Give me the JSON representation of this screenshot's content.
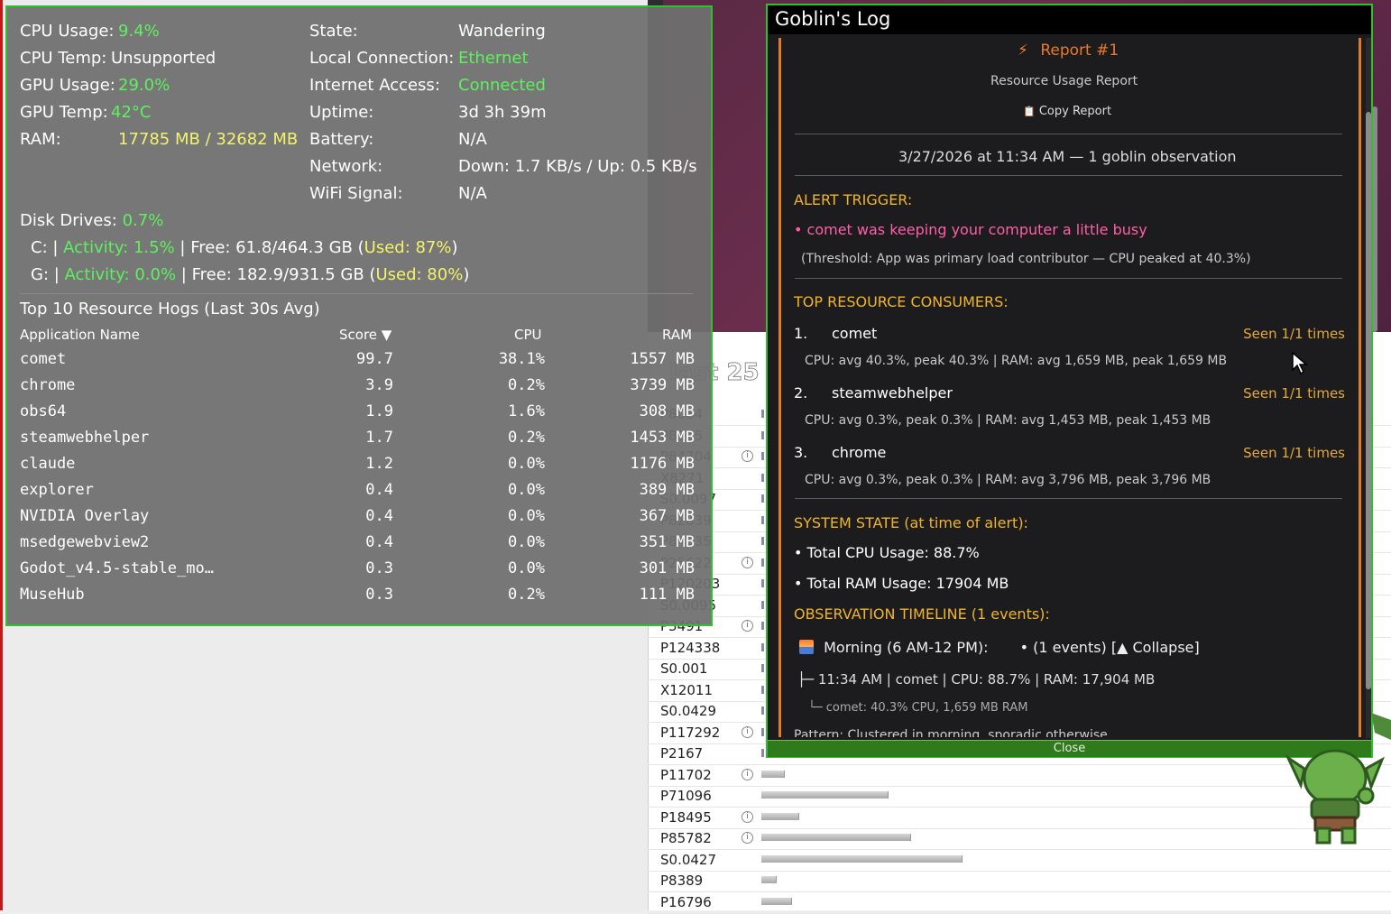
{
  "stats": {
    "left": [
      {
        "label": "CPU Usage:",
        "value": "9.4%",
        "color": "green"
      },
      {
        "label": "CPU Temp:",
        "value": "Unsupported",
        "color": "white"
      },
      {
        "label": "GPU Usage:",
        "value": "29.0%",
        "color": "green"
      },
      {
        "label": "GPU Temp:",
        "value": "42°C",
        "color": "green"
      },
      {
        "label": "RAM:",
        "value": "17785 MB / 32682 MB",
        "color": "yellow"
      }
    ],
    "right": [
      {
        "label": "State:",
        "value": "Wandering",
        "color": "white"
      },
      {
        "label": "Local Connection:",
        "value": "Ethernet",
        "color": "green"
      },
      {
        "label": "Internet Access:",
        "value": "Connected",
        "color": "green"
      },
      {
        "label": "Uptime:",
        "value": "3d 3h 39m",
        "color": "white"
      },
      {
        "label": "Battery:",
        "value": "N/A",
        "color": "white"
      },
      {
        "label": "Network:",
        "value": "Down: 1.7 KB/s / Up: 0.5 KB/s",
        "color": "white"
      },
      {
        "label": "WiFi Signal:",
        "value": "N/A",
        "color": "white"
      }
    ],
    "disk": {
      "label": "Disk Drives:",
      "value": "0.7%",
      "drives": [
        {
          "name": "C:",
          "activity": "Activity: 1.5%",
          "free": "Free: 61.8/464.3 GB",
          "used": "Used: 87%"
        },
        {
          "name": "G:",
          "activity": "Activity: 0.0%",
          "free": "Free: 182.9/931.5 GB",
          "used": "Used: 80%"
        }
      ]
    },
    "top_title": "Top 10 Resource Hogs (Last 30s Avg)",
    "columns": {
      "name": "Application Name",
      "score": "Score ▼",
      "cpu": "CPU",
      "ram": "RAM"
    },
    "apps": [
      {
        "name": "comet",
        "score": "99.7",
        "cpu": "38.1%",
        "ram": "1557 MB"
      },
      {
        "name": "chrome",
        "score": "3.9",
        "cpu": "0.2%",
        "ram": "3739 MB"
      },
      {
        "name": "obs64",
        "score": "1.9",
        "cpu": "1.6%",
        "ram": "308 MB"
      },
      {
        "name": "steamwebhelper",
        "score": "1.7",
        "cpu": "0.2%",
        "ram": "1453 MB"
      },
      {
        "name": "claude",
        "score": "1.2",
        "cpu": "0.0%",
        "ram": "1176 MB"
      },
      {
        "name": "explorer",
        "score": "0.4",
        "cpu": "0.0%",
        "ram": "389 MB"
      },
      {
        "name": "NVIDIA Overlay",
        "score": "0.4",
        "cpu": "0.0%",
        "ram": "367 MB"
      },
      {
        "name": "msedgewebview2",
        "score": "0.4",
        "cpu": "0.0%",
        "ram": "351 MB"
      },
      {
        "name": "Godot_v4.5-stable_mo…",
        "score": "0.3",
        "cpu": "0.0%",
        "ram": "301 MB"
      },
      {
        "name": "MuseHub",
        "score": "0.3",
        "cpu": "0.2%",
        "ram": "111 MB"
      }
    ]
  },
  "background": {
    "overlay_text": "last 25",
    "rows": [
      {
        "label": "P8084",
        "info": false,
        "bar": 0
      },
      {
        "label": "P8005",
        "info": false,
        "bar": 0
      },
      {
        "label": "P84704",
        "info": true,
        "bar": 0
      },
      {
        "label": "X8271",
        "info": false,
        "bar": 0
      },
      {
        "label": "S0.0097",
        "info": false,
        "bar": 0
      },
      {
        "label": "P82839",
        "info": false,
        "bar": 0
      },
      {
        "label": "P84035",
        "info": false,
        "bar": 0
      },
      {
        "label": "P25622",
        "info": true,
        "bar": 0
      },
      {
        "label": "P120203",
        "info": false,
        "bar": 0
      },
      {
        "label": "S0.0095",
        "info": false,
        "bar": 0
      },
      {
        "label": "P3491",
        "info": true,
        "bar": 0
      },
      {
        "label": "P124338",
        "info": false,
        "bar": 0
      },
      {
        "label": "S0.001",
        "info": false,
        "bar": 0
      },
      {
        "label": "X12011",
        "info": false,
        "bar": 0
      },
      {
        "label": "S0.0429",
        "info": false,
        "bar": 0
      },
      {
        "label": "P117292",
        "info": true,
        "bar": 0
      },
      {
        "label": "P2167",
        "info": false,
        "bar": 0
      },
      {
        "label": "P11702",
        "info": true,
        "bar": 0.03
      },
      {
        "label": "P71096",
        "info": false,
        "bar": 0.17
      },
      {
        "label": "P18495",
        "info": true,
        "bar": 0.05
      },
      {
        "label": "P85782",
        "info": true,
        "bar": 0.2
      },
      {
        "label": "S0.0427",
        "info": false,
        "bar": 0.27
      },
      {
        "label": "P8389",
        "info": false,
        "bar": 0.02
      },
      {
        "label": "P16796",
        "info": false,
        "bar": 0.04
      }
    ]
  },
  "log": {
    "title": "Goblin's Log",
    "report_icon": "⚡",
    "report_title": "Report #1",
    "subtitle": "Resource Usage Report",
    "copy_icon": "📋",
    "copy_label": "Copy Report",
    "date_line": "3/27/2026 at 11:34 AM — 1 goblin observation",
    "alert_heading": "ALERT TRIGGER:",
    "alert_text": "• comet was keeping your computer a little busy",
    "threshold": "(Threshold: App was primary load contributor — CPU peaked at 40.3%)",
    "consumers_heading": "TOP RESOURCE CONSUMERS:",
    "consumers": [
      {
        "rank": "1.",
        "name": "comet",
        "seen": "Seen 1/1 times",
        "detail": "CPU: avg 40.3%, peak 40.3% | RAM: avg 1,659 MB, peak 1,659 MB"
      },
      {
        "rank": "2.",
        "name": "steamwebhelper",
        "seen": "Seen 1/1 times",
        "detail": "CPU: avg 0.3%, peak 0.3% | RAM: avg 1,453 MB, peak 1,453 MB"
      },
      {
        "rank": "3.",
        "name": "chrome",
        "seen": "Seen 1/1 times",
        "detail": "CPU: avg 0.3%, peak 0.3% | RAM: avg 3,796 MB, peak 3,796 MB"
      }
    ],
    "system_heading": "SYSTEM STATE (at time of alert):",
    "system_cpu": "• Total CPU Usage: 88.7%",
    "system_ram": "• Total RAM Usage: 17904 MB",
    "timeline_heading": "OBSERVATION TIMELINE (1 events):",
    "timeline_period": "Morning (6 AM-12 PM):",
    "timeline_toggle": "• (1 events) [▲ Collapse]",
    "timeline_entry": "├─ 11:34 AM | comet | CPU: 88.7% | RAM: 17,904 MB",
    "timeline_sub": "└─ comet: 40.3% CPU, 1,659 MB RAM",
    "pattern": "Pattern: Clustered in morning, sporadic otherwise",
    "close_label": "Close"
  }
}
